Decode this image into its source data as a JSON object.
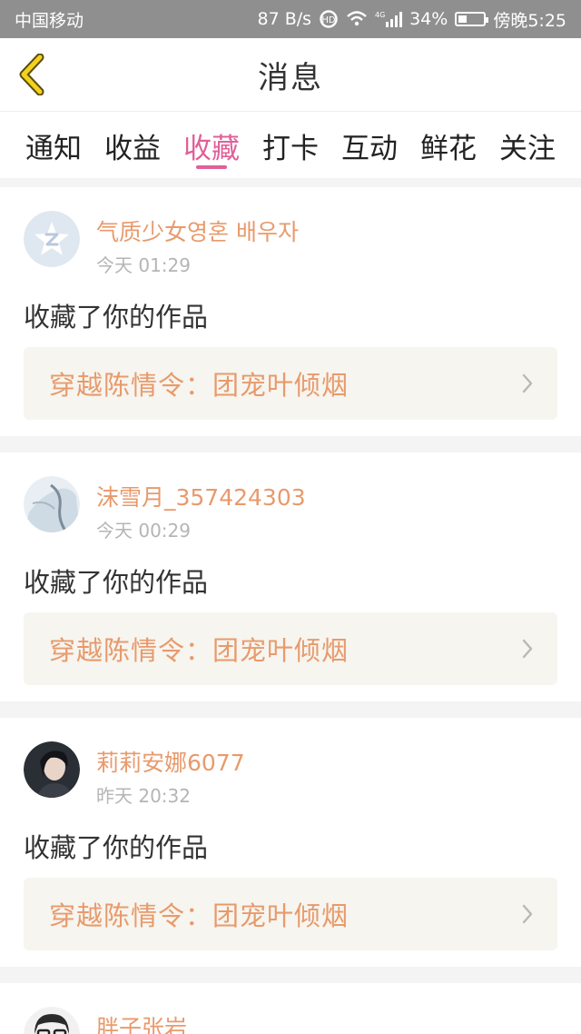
{
  "status_bar": {
    "carrier": "中国移动",
    "speed": "87 B/s",
    "battery": "34%",
    "battery_level": 0.34,
    "time": "傍晚5:25",
    "icons": [
      "hd-icon",
      "wifi-icon",
      "signal-4g-icon",
      "battery-icon"
    ]
  },
  "header": {
    "title": "消息",
    "back_icon": "chevron-left-icon"
  },
  "tabs": [
    {
      "label": "通知"
    },
    {
      "label": "收益"
    },
    {
      "label": "收藏",
      "active": true
    },
    {
      "label": "打卡"
    },
    {
      "label": "互动"
    },
    {
      "label": "鲜花"
    },
    {
      "label": "关注"
    }
  ],
  "accent_color": "#e0609a",
  "name_color": "#e89a6c",
  "items": [
    {
      "user": "气质少女영혼 배우자",
      "time": "今天 01:29",
      "action": "收藏了你的作品",
      "work": "穿越陈情令：团宠叶倾烟",
      "avatar": "default-avatar"
    },
    {
      "user": "沫雪月_357424303",
      "time": "今天 00:29",
      "action": "收藏了你的作品",
      "work": "穿越陈情令：团宠叶倾烟",
      "avatar": "photo-avatar"
    },
    {
      "user": "莉莉安娜6077",
      "time": "昨天 20:32",
      "action": "收藏了你的作品",
      "work": "穿越陈情令：团宠叶倾烟",
      "avatar": "photo-avatar"
    },
    {
      "user": "胖子张岩",
      "avatar": "photo-avatar"
    }
  ]
}
